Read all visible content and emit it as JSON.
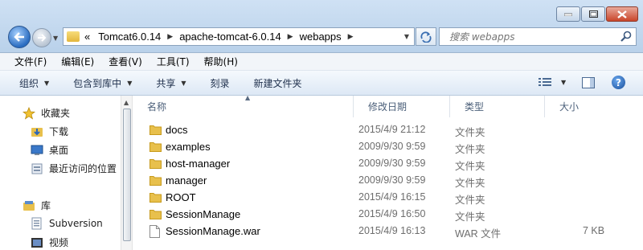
{
  "address": {
    "overflow": "«",
    "crumbs": [
      "Tomcat6.0.14",
      "apache-tomcat-6.0.14",
      "webapps"
    ]
  },
  "search": {
    "placeholder": "搜索 webapps"
  },
  "menu": [
    "文件(F)",
    "编辑(E)",
    "查看(V)",
    "工具(T)",
    "帮助(H)"
  ],
  "toolbar": {
    "organize": "组织",
    "include_library": "包含到库中",
    "share": "共享",
    "burn": "刻录",
    "new_folder": "新建文件夹",
    "help": "?"
  },
  "sidebar": {
    "favorites": "收藏夹",
    "downloads": "下载",
    "desktop": "桌面",
    "recent": "最近访问的位置",
    "libraries": "库",
    "subversion": "Subversion",
    "videos": "视频"
  },
  "columns": {
    "name": "名称",
    "modified": "修改日期",
    "type": "类型",
    "size": "大小"
  },
  "files": [
    {
      "name": "docs",
      "modified": "2015/4/9 21:12",
      "type": "文件夹",
      "size": "",
      "icon": "folder-icon"
    },
    {
      "name": "examples",
      "modified": "2009/9/30 9:59",
      "type": "文件夹",
      "size": "",
      "icon": "folder-icon"
    },
    {
      "name": "host-manager",
      "modified": "2009/9/30 9:59",
      "type": "文件夹",
      "size": "",
      "icon": "folder-icon"
    },
    {
      "name": "manager",
      "modified": "2009/9/30 9:59",
      "type": "文件夹",
      "size": "",
      "icon": "folder-icon"
    },
    {
      "name": "ROOT",
      "modified": "2015/4/9 16:15",
      "type": "文件夹",
      "size": "",
      "icon": "folder-icon"
    },
    {
      "name": "SessionManage",
      "modified": "2015/4/9 16:50",
      "type": "文件夹",
      "size": "",
      "icon": "folder-icon"
    },
    {
      "name": "SessionManage.war",
      "modified": "2015/4/9 16:13",
      "type": "WAR 文件",
      "size": "7 KB",
      "icon": "file-icon"
    }
  ],
  "colors": {
    "folder": "#e8c04c",
    "title_bar": "#c4d9f0",
    "toolbar": "#dde8f5"
  }
}
